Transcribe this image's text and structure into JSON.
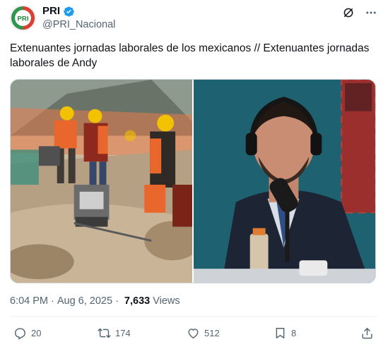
{
  "account": {
    "display_name": "PRI",
    "handle": "@PRI_Nacional",
    "avatar_text": "PRI",
    "verified": true
  },
  "tweet": {
    "text": "Extenuantes jornadas laborales de los mexicanos // Extenuantes jornadas laborales de Andy"
  },
  "media": {
    "left_image": "construction-workers-photo",
    "right_image": "man-with-headphones-microphone-photo"
  },
  "meta": {
    "time": "6:04 PM",
    "separator": "·",
    "date": "Aug 6, 2025",
    "views_count": "7,633",
    "views_label": "Views"
  },
  "actions": {
    "reply_count": "20",
    "repost_count": "174",
    "like_count": "512",
    "bookmark_count": "8"
  },
  "colors": {
    "text_primary": "#0f1419",
    "text_secondary": "#536471",
    "verified_blue": "#1d9bf0",
    "pri_green": "#1a8a3c",
    "pri_red": "#d52b1e"
  },
  "icons": [
    "verified-badge-icon",
    "grok-icon",
    "more-icon",
    "reply-icon",
    "repost-icon",
    "like-icon",
    "bookmark-icon",
    "share-icon"
  ]
}
